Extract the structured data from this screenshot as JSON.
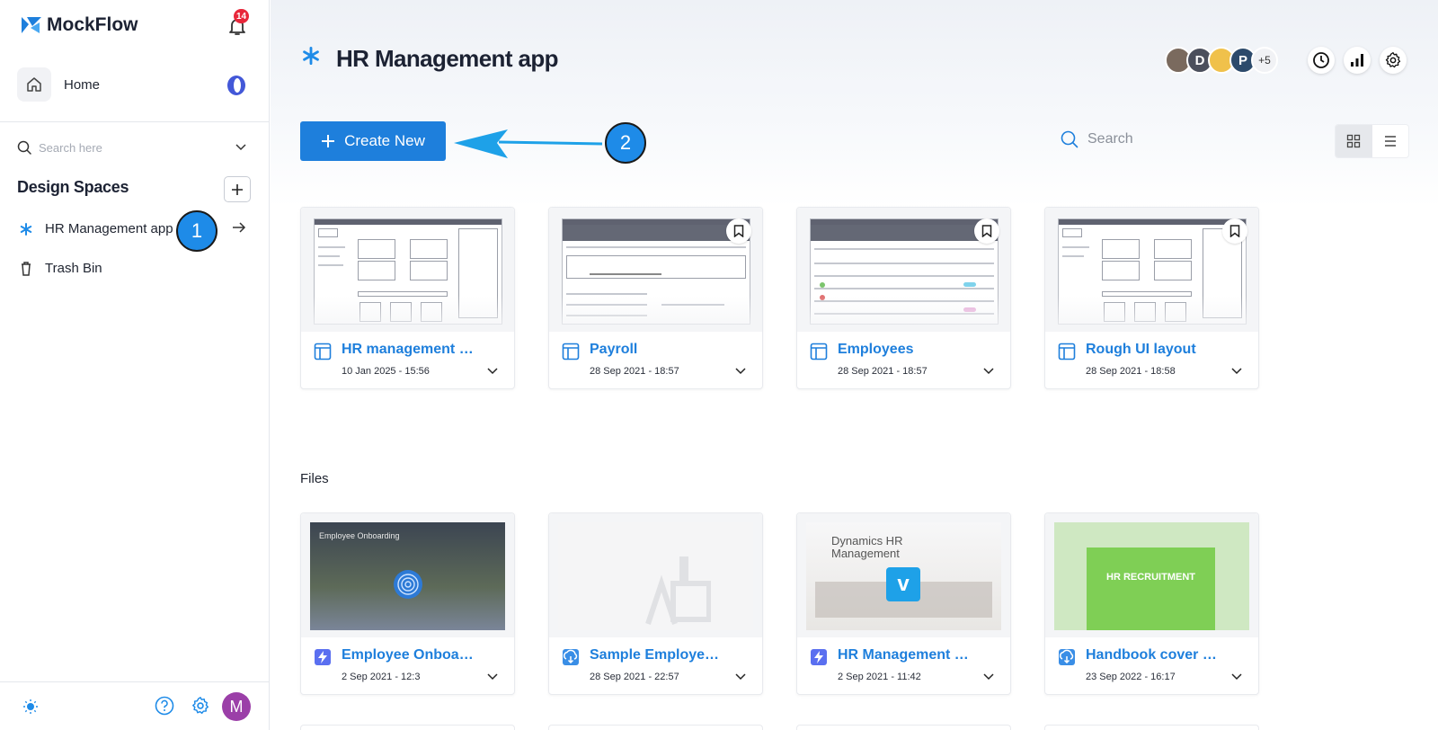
{
  "app": {
    "logo_text": "MockFlow",
    "notification_count": "14"
  },
  "sidebar": {
    "home_label": "Home",
    "search_placeholder": "Search here",
    "design_spaces_title": "Design Spaces",
    "items": [
      {
        "label": "HR Management app",
        "icon": "asterisk-icon"
      },
      {
        "label": "Trash Bin",
        "icon": "trash-icon"
      }
    ],
    "callout_1": "1",
    "user_initial": "M"
  },
  "header": {
    "title": "HR Management app",
    "avatars": [
      "",
      "D",
      "",
      "P"
    ],
    "more_members": "+5"
  },
  "toolbar": {
    "create_label": "Create New",
    "callout_2": "2",
    "search_placeholder": "Search"
  },
  "projects": [
    {
      "title": "HR management app",
      "date": "10 Jan 2025 - 15:56",
      "type": "wireframe"
    },
    {
      "title": "Payroll",
      "date": "28 Sep 2021 - 18:57",
      "type": "wireframe"
    },
    {
      "title": "Employees",
      "date": "28 Sep 2021 - 18:57",
      "type": "wireframe"
    },
    {
      "title": "Rough UI layout",
      "date": "28 Sep 2021 - 18:58",
      "type": "wireframe"
    }
  ],
  "files_label": "Files",
  "files": [
    {
      "title": "Employee Onboarding",
      "date": "2 Sep 2021 - 12:3",
      "thumb_text": "Employee Onboarding",
      "type": "flash"
    },
    {
      "title": "Sample Employee Handbook",
      "date": "28 Sep 2021 - 22:57",
      "type": "upload"
    },
    {
      "title": "HR Management Dynamics",
      "date": "2 Sep 2021 - 11:42",
      "thumb_text": "Dynamics HR Management",
      "type": "flash"
    },
    {
      "title": "Handbook cover art",
      "date": "23 Sep 2022 - 16:17",
      "thumb_text": "HR RECRUITMENT",
      "type": "upload"
    }
  ],
  "colors": {
    "accent": "#1e7fdc",
    "callout": "#1e8be8",
    "badge": "#e8273b"
  }
}
